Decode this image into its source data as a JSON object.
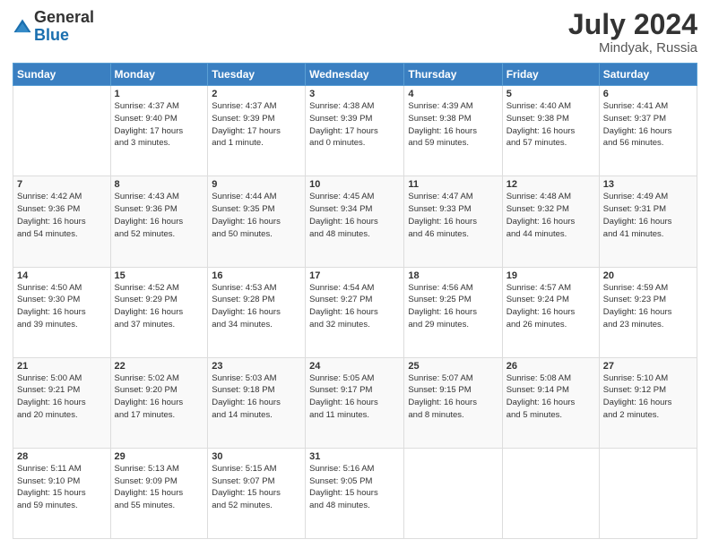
{
  "header": {
    "logo_general": "General",
    "logo_blue": "Blue",
    "month_year": "July 2024",
    "location": "Mindyak, Russia"
  },
  "days_of_week": [
    "Sunday",
    "Monday",
    "Tuesday",
    "Wednesday",
    "Thursday",
    "Friday",
    "Saturday"
  ],
  "weeks": [
    [
      {
        "day": "",
        "content": ""
      },
      {
        "day": "1",
        "content": "Sunrise: 4:37 AM\nSunset: 9:40 PM\nDaylight: 17 hours\nand 3 minutes."
      },
      {
        "day": "2",
        "content": "Sunrise: 4:37 AM\nSunset: 9:39 PM\nDaylight: 17 hours\nand 1 minute."
      },
      {
        "day": "3",
        "content": "Sunrise: 4:38 AM\nSunset: 9:39 PM\nDaylight: 17 hours\nand 0 minutes."
      },
      {
        "day": "4",
        "content": "Sunrise: 4:39 AM\nSunset: 9:38 PM\nDaylight: 16 hours\nand 59 minutes."
      },
      {
        "day": "5",
        "content": "Sunrise: 4:40 AM\nSunset: 9:38 PM\nDaylight: 16 hours\nand 57 minutes."
      },
      {
        "day": "6",
        "content": "Sunrise: 4:41 AM\nSunset: 9:37 PM\nDaylight: 16 hours\nand 56 minutes."
      }
    ],
    [
      {
        "day": "7",
        "content": "Sunrise: 4:42 AM\nSunset: 9:36 PM\nDaylight: 16 hours\nand 54 minutes."
      },
      {
        "day": "8",
        "content": "Sunrise: 4:43 AM\nSunset: 9:36 PM\nDaylight: 16 hours\nand 52 minutes."
      },
      {
        "day": "9",
        "content": "Sunrise: 4:44 AM\nSunset: 9:35 PM\nDaylight: 16 hours\nand 50 minutes."
      },
      {
        "day": "10",
        "content": "Sunrise: 4:45 AM\nSunset: 9:34 PM\nDaylight: 16 hours\nand 48 minutes."
      },
      {
        "day": "11",
        "content": "Sunrise: 4:47 AM\nSunset: 9:33 PM\nDaylight: 16 hours\nand 46 minutes."
      },
      {
        "day": "12",
        "content": "Sunrise: 4:48 AM\nSunset: 9:32 PM\nDaylight: 16 hours\nand 44 minutes."
      },
      {
        "day": "13",
        "content": "Sunrise: 4:49 AM\nSunset: 9:31 PM\nDaylight: 16 hours\nand 41 minutes."
      }
    ],
    [
      {
        "day": "14",
        "content": "Sunrise: 4:50 AM\nSunset: 9:30 PM\nDaylight: 16 hours\nand 39 minutes."
      },
      {
        "day": "15",
        "content": "Sunrise: 4:52 AM\nSunset: 9:29 PM\nDaylight: 16 hours\nand 37 minutes."
      },
      {
        "day": "16",
        "content": "Sunrise: 4:53 AM\nSunset: 9:28 PM\nDaylight: 16 hours\nand 34 minutes."
      },
      {
        "day": "17",
        "content": "Sunrise: 4:54 AM\nSunset: 9:27 PM\nDaylight: 16 hours\nand 32 minutes."
      },
      {
        "day": "18",
        "content": "Sunrise: 4:56 AM\nSunset: 9:25 PM\nDaylight: 16 hours\nand 29 minutes."
      },
      {
        "day": "19",
        "content": "Sunrise: 4:57 AM\nSunset: 9:24 PM\nDaylight: 16 hours\nand 26 minutes."
      },
      {
        "day": "20",
        "content": "Sunrise: 4:59 AM\nSunset: 9:23 PM\nDaylight: 16 hours\nand 23 minutes."
      }
    ],
    [
      {
        "day": "21",
        "content": "Sunrise: 5:00 AM\nSunset: 9:21 PM\nDaylight: 16 hours\nand 20 minutes."
      },
      {
        "day": "22",
        "content": "Sunrise: 5:02 AM\nSunset: 9:20 PM\nDaylight: 16 hours\nand 17 minutes."
      },
      {
        "day": "23",
        "content": "Sunrise: 5:03 AM\nSunset: 9:18 PM\nDaylight: 16 hours\nand 14 minutes."
      },
      {
        "day": "24",
        "content": "Sunrise: 5:05 AM\nSunset: 9:17 PM\nDaylight: 16 hours\nand 11 minutes."
      },
      {
        "day": "25",
        "content": "Sunrise: 5:07 AM\nSunset: 9:15 PM\nDaylight: 16 hours\nand 8 minutes."
      },
      {
        "day": "26",
        "content": "Sunrise: 5:08 AM\nSunset: 9:14 PM\nDaylight: 16 hours\nand 5 minutes."
      },
      {
        "day": "27",
        "content": "Sunrise: 5:10 AM\nSunset: 9:12 PM\nDaylight: 16 hours\nand 2 minutes."
      }
    ],
    [
      {
        "day": "28",
        "content": "Sunrise: 5:11 AM\nSunset: 9:10 PM\nDaylight: 15 hours\nand 59 minutes."
      },
      {
        "day": "29",
        "content": "Sunrise: 5:13 AM\nSunset: 9:09 PM\nDaylight: 15 hours\nand 55 minutes."
      },
      {
        "day": "30",
        "content": "Sunrise: 5:15 AM\nSunset: 9:07 PM\nDaylight: 15 hours\nand 52 minutes."
      },
      {
        "day": "31",
        "content": "Sunrise: 5:16 AM\nSunset: 9:05 PM\nDaylight: 15 hours\nand 48 minutes."
      },
      {
        "day": "",
        "content": ""
      },
      {
        "day": "",
        "content": ""
      },
      {
        "day": "",
        "content": ""
      }
    ]
  ]
}
